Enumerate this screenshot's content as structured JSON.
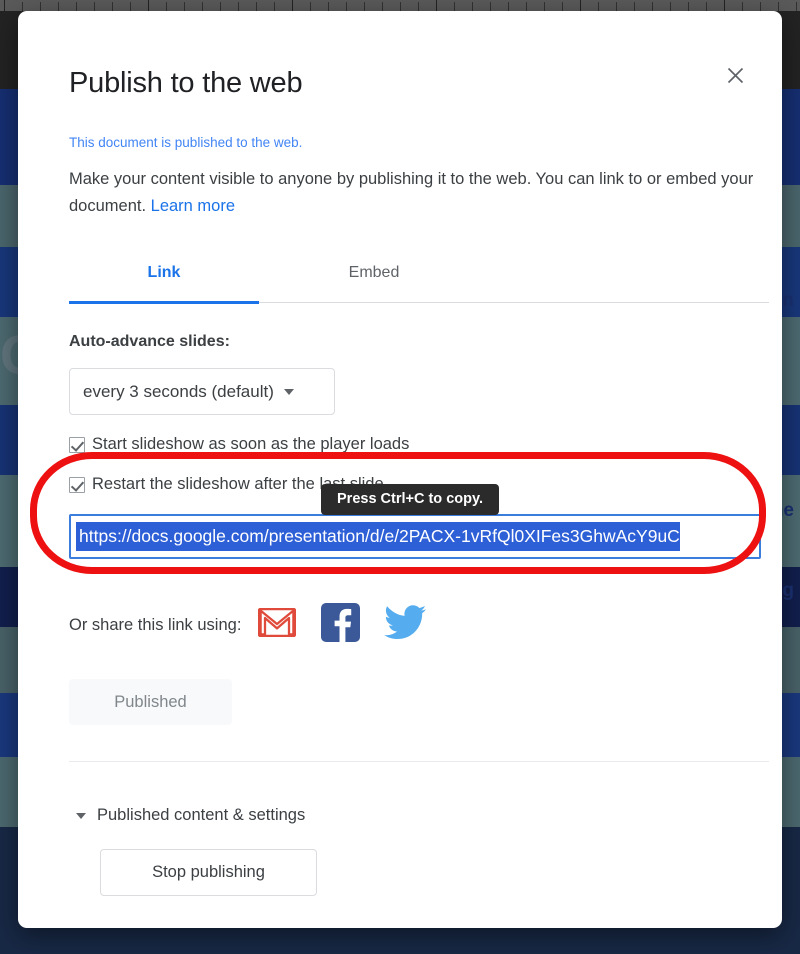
{
  "dialog": {
    "title": "Publish to the web",
    "close_icon": "close-icon",
    "published_notice": "This document is published to the web.",
    "description_text": "Make your content visible to anyone by publishing it to the web. You can link to or embed your document.",
    "learn_more_label": "Learn more",
    "tabs": [
      {
        "label": "Link",
        "active": true
      },
      {
        "label": "Embed",
        "active": false
      }
    ],
    "auto_advance_label": "Auto-advance slides:",
    "interval_select": {
      "value": "every 3 seconds (default)",
      "caret_icon": "chevron-down-icon"
    },
    "checkboxes": [
      {
        "label": "Start slideshow as soon as the player loads",
        "checked": true
      },
      {
        "label": "Restart the slideshow after the last slide",
        "checked": true
      }
    ],
    "url_field": {
      "value": "https://docs.google.com/presentation/d/e/2PACX-1vRfQl0XIFes3GhwAcY9uC",
      "selected": true
    },
    "tooltip": "Press Ctrl+C to copy.",
    "share_label": "Or share this link using:",
    "share_icons": [
      {
        "name": "gmail-icon",
        "title": "Gmail"
      },
      {
        "name": "facebook-icon",
        "title": "Facebook"
      },
      {
        "name": "twitter-icon",
        "title": "Twitter"
      }
    ],
    "published_button_label": "Published",
    "settings_toggle_label": "Published content & settings",
    "settings_toggle_icon": "caret-down-icon",
    "stop_publishing_label": "Stop publishing"
  },
  "annotation": {
    "shape": "oval",
    "color": "#ee1111"
  },
  "colors": {
    "accent_blue": "#1a73e8",
    "link_blue": "#4285f4",
    "selection_blue": "#2d5fd7",
    "field_border": "#3b7ddd",
    "tooltip_bg": "#2b2b2b",
    "annotation_red": "#ee1111",
    "gmail_red": "#e04a3a",
    "facebook_blue": "#3b5998",
    "twitter_blue": "#55acee",
    "backdrop_navy": "#1e3356"
  },
  "background": {
    "ruler_present": true,
    "slide_letter": "C",
    "texts": [
      "on",
      "ne",
      "ing"
    ]
  }
}
